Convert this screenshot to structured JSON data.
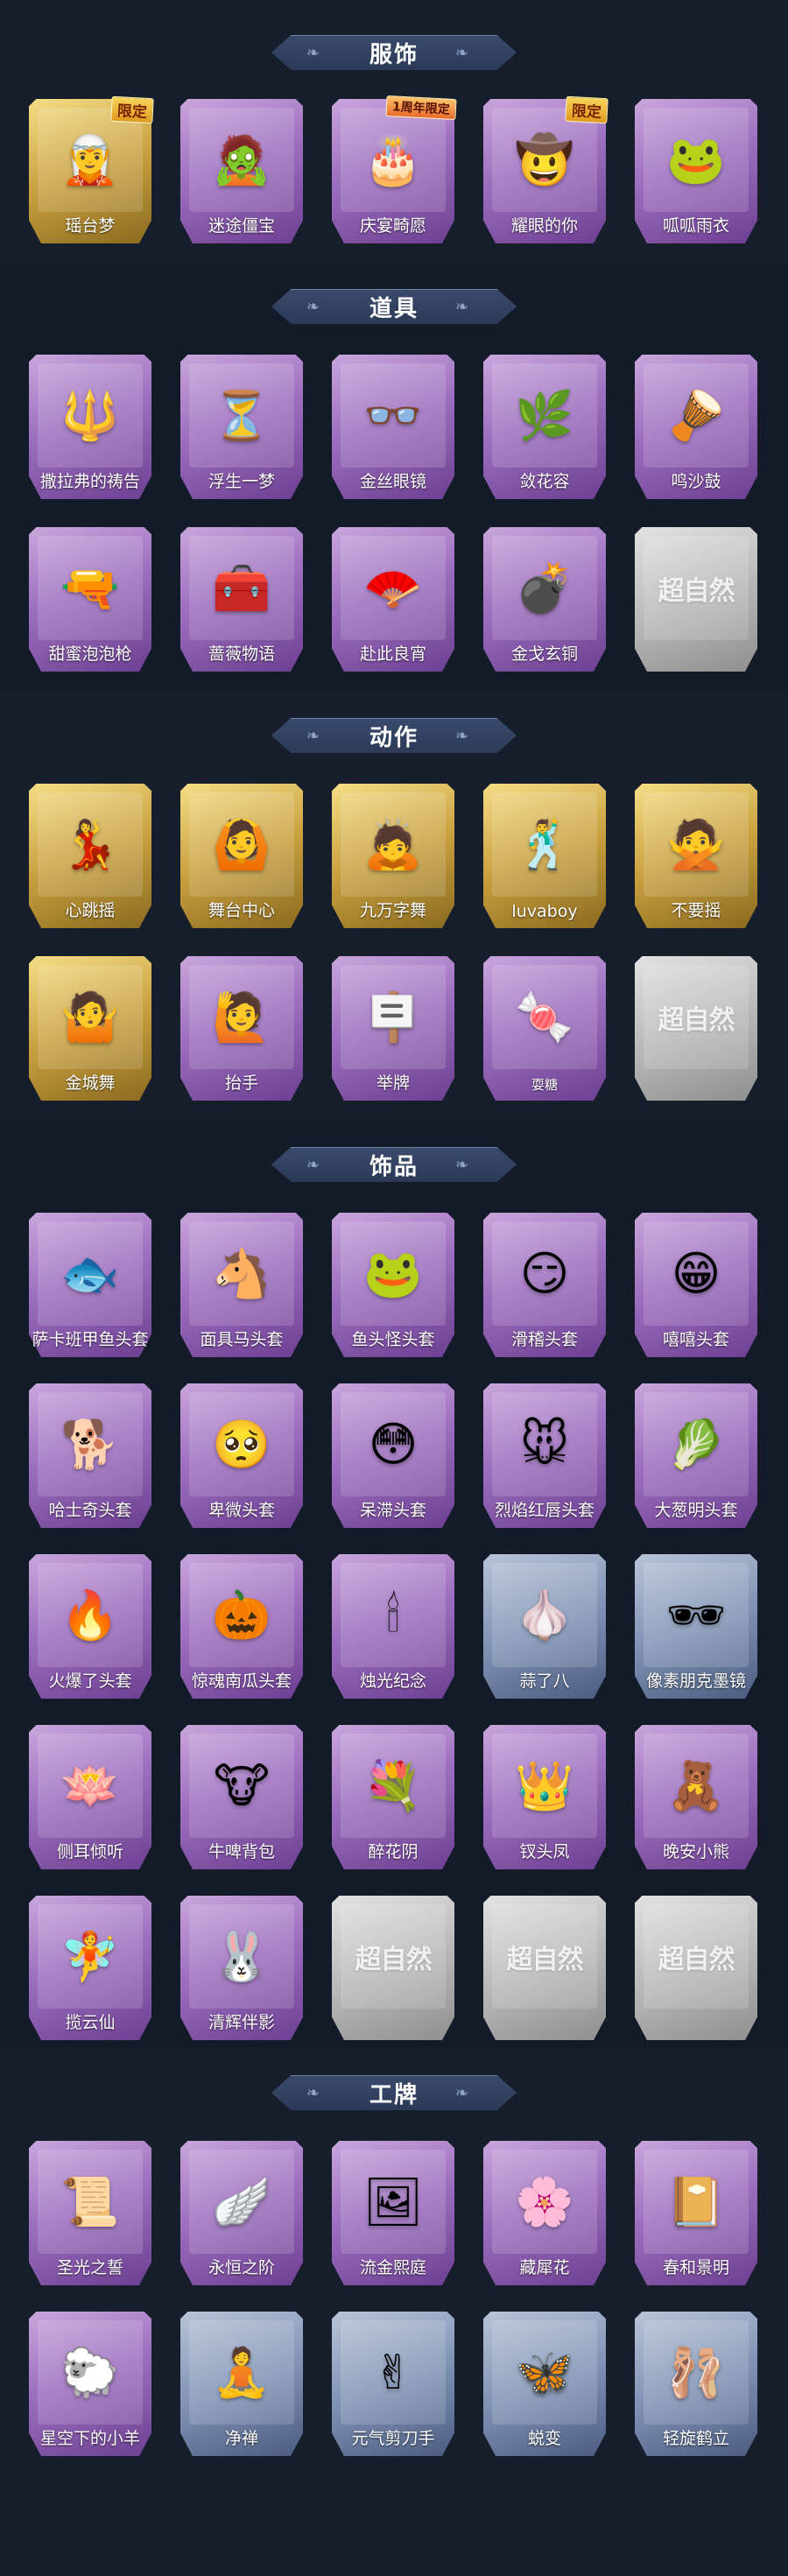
{
  "sections": [
    {
      "title": "服饰",
      "items": [
        {
          "label": "瑶台梦",
          "icon": "🧝",
          "style": "gold",
          "badge": "限定"
        },
        {
          "label": "迷途僵宝",
          "icon": "🧟",
          "style": "purple"
        },
        {
          "label": "庆宴畸愿",
          "icon": "🎂",
          "style": "purple",
          "badge": "1周年限定"
        },
        {
          "label": "耀眼的你",
          "icon": "🤠",
          "style": "purple",
          "badge": "限定"
        },
        {
          "label": "呱呱雨衣",
          "icon": "🐸",
          "style": "purple"
        }
      ]
    },
    {
      "title": "道具",
      "items": [
        {
          "label": "撒拉弗的祷告",
          "icon": "🔱",
          "style": "purple"
        },
        {
          "label": "浮生一梦",
          "icon": "⏳",
          "style": "purple"
        },
        {
          "label": "金丝眼镜",
          "icon": "👓",
          "style": "purple"
        },
        {
          "label": "敛花容",
          "icon": "🌿",
          "style": "purple"
        },
        {
          "label": "鸣沙鼓",
          "icon": "🪘",
          "style": "purple"
        },
        {
          "label": "甜蜜泡泡枪",
          "icon": "🔫",
          "style": "purple"
        },
        {
          "label": "蔷薇物语",
          "icon": "🧰",
          "style": "purple"
        },
        {
          "label": "赴此良宵",
          "icon": "🪭",
          "style": "purple"
        },
        {
          "label": "金戈玄铜",
          "icon": "💣",
          "style": "purple"
        },
        {
          "label": "",
          "icon": "",
          "style": "grey",
          "watermark": "超自然"
        }
      ]
    },
    {
      "title": "动作",
      "items": [
        {
          "label": "心跳摇",
          "icon": "💃",
          "style": "gold"
        },
        {
          "label": "舞台中心",
          "icon": "🙆",
          "style": "gold"
        },
        {
          "label": "九万字舞",
          "icon": "🙇",
          "style": "gold"
        },
        {
          "label": "luvaboy",
          "icon": "🕺",
          "style": "gold"
        },
        {
          "label": "不要摇",
          "icon": "🙅",
          "style": "gold"
        },
        {
          "label": "金城舞",
          "icon": "🤷",
          "style": "gold"
        },
        {
          "label": "抬手",
          "icon": "🙋",
          "style": "purple"
        },
        {
          "label": "举牌",
          "icon": "🪧",
          "style": "purple"
        },
        {
          "label": "耍糖",
          "icon": "🍬",
          "style": "purple",
          "small": true
        },
        {
          "label": "",
          "icon": "",
          "style": "grey",
          "watermark": "超自然"
        }
      ]
    },
    {
      "title": "饰品",
      "items": [
        {
          "label": "萨卡班甲鱼头套",
          "icon": "🐟",
          "style": "purple"
        },
        {
          "label": "面具马头套",
          "icon": "🐴",
          "style": "purple"
        },
        {
          "label": "鱼头怪头套",
          "icon": "🐸",
          "style": "purple"
        },
        {
          "label": "滑稽头套",
          "icon": "😏",
          "style": "purple"
        },
        {
          "label": "嘻嘻头套",
          "icon": "😁",
          "style": "purple"
        },
        {
          "label": "哈士奇头套",
          "icon": "🐕",
          "style": "purple"
        },
        {
          "label": "卑微头套",
          "icon": "🥺",
          "style": "purple"
        },
        {
          "label": "呆滞头套",
          "icon": "😳",
          "style": "purple"
        },
        {
          "label": "烈焰红唇头套",
          "icon": "🐭",
          "style": "purple"
        },
        {
          "label": "大葱明头套",
          "icon": "🥬",
          "style": "purple"
        },
        {
          "label": "火爆了头套",
          "icon": "🔥",
          "style": "purple"
        },
        {
          "label": "惊魂南瓜头套",
          "icon": "🎃",
          "style": "purple"
        },
        {
          "label": "烛光纪念",
          "icon": "🕯",
          "style": "purple"
        },
        {
          "label": "蒜了八",
          "icon": "🧄",
          "style": "blue"
        },
        {
          "label": "像素朋克墨镜",
          "icon": "🕶",
          "style": "blue"
        },
        {
          "label": "侧耳倾听",
          "icon": "🪷",
          "style": "purple"
        },
        {
          "label": "牛啤背包",
          "icon": "🐮",
          "style": "purple"
        },
        {
          "label": "醉花阴",
          "icon": "💐",
          "style": "purple"
        },
        {
          "label": "钗头凤",
          "icon": "👑",
          "style": "purple"
        },
        {
          "label": "晚安小熊",
          "icon": "🧸",
          "style": "purple"
        },
        {
          "label": "揽云仙",
          "icon": "🧚",
          "style": "purple"
        },
        {
          "label": "清辉伴影",
          "icon": "🐰",
          "style": "purple"
        },
        {
          "label": "",
          "icon": "",
          "style": "grey",
          "watermark": "超自然"
        },
        {
          "label": "",
          "icon": "",
          "style": "grey",
          "watermark": "超自然"
        },
        {
          "label": "",
          "icon": "",
          "style": "grey",
          "watermark": "超自然"
        }
      ]
    },
    {
      "title": "工牌",
      "items": [
        {
          "label": "圣光之誓",
          "icon": "📜",
          "style": "purple"
        },
        {
          "label": "永恒之阶",
          "icon": "🪽",
          "style": "purple"
        },
        {
          "label": "流金熙庭",
          "icon": "🖼",
          "style": "purple"
        },
        {
          "label": "藏犀花",
          "icon": "🌸",
          "style": "purple"
        },
        {
          "label": "春和景明",
          "icon": "📔",
          "style": "purple"
        },
        {
          "label": "星空下的小羊",
          "icon": "🐑",
          "style": "purple"
        },
        {
          "label": "净禅",
          "icon": "🧘",
          "style": "blue"
        },
        {
          "label": "元气剪刀手",
          "icon": "✌",
          "style": "blue"
        },
        {
          "label": "蜕变",
          "icon": "🦋",
          "style": "blue"
        },
        {
          "label": "轻旋鹤立",
          "icon": "🩰",
          "style": "blue"
        }
      ]
    }
  ]
}
